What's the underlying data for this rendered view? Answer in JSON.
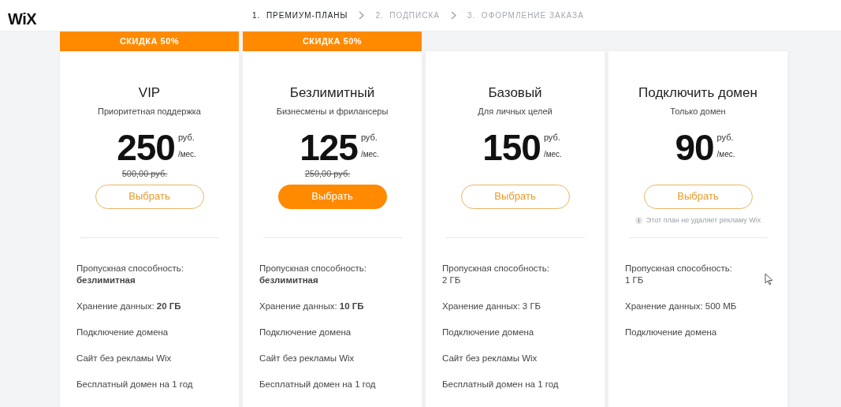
{
  "logo": "WiX",
  "steps": [
    {
      "number": "1.",
      "label": "ПРЕМИУМ-ПЛАНЫ",
      "selected": true
    },
    {
      "number": "2.",
      "label": "ПОДПИСКА",
      "selected": false
    },
    {
      "number": "3.",
      "label": "ОФОРМЛЕНИЕ ЗАКАЗА",
      "selected": false
    }
  ],
  "plans": [
    {
      "badge": "СКИДКА 50%",
      "name": "VIP",
      "subtitle": "Приоритетная поддержка",
      "price": "250",
      "currency": "руб.",
      "period": "/мес.",
      "old_price": "500,00 руб.",
      "button": {
        "label": "Выбрать",
        "primary": false
      },
      "features": [
        "Пропускная способность:\n**безлимитная**",
        "Хранение данных: **20 ГБ**",
        "Подключение домена",
        "Сайт без рекламы Wix",
        "Бесплатный домен на 1 год"
      ]
    },
    {
      "badge": "СКИДКА 50%",
      "name": "Безлимитный",
      "subtitle": "Бизнесмены и фрилансеры",
      "price": "125",
      "currency": "руб.",
      "period": "/мес.",
      "old_price": "250,00 руб.",
      "button": {
        "label": "Выбрать",
        "primary": true
      },
      "features": [
        "Пропускная способность:\n**безлимитная**",
        "Хранение данных: **10 ГБ**",
        "Подключение домена",
        "Сайт без рекламы Wix",
        "Бесплатный домен на 1 год"
      ]
    },
    {
      "name": "Базовый",
      "subtitle": "Для личных целей",
      "price": "150",
      "currency": "руб.",
      "period": "/мес.",
      "button": {
        "label": "Выбрать",
        "primary": false
      },
      "features": [
        "Пропускная способность:\n2 ГБ",
        "Хранение данных: 3 ГБ",
        "Подключение домена",
        "Сайт без рекламы Wix",
        "Бесплатный домен на 1 год"
      ]
    },
    {
      "name": "Подключить домен",
      "subtitle": "Только домен",
      "price": "90",
      "currency": "руб.",
      "period": "/мес.",
      "button": {
        "label": "Выбрать",
        "primary": false
      },
      "note": "Этот план не удаляет рекламу Wix",
      "features": [
        "Пропускная способность:\n1 ГБ",
        "Хранение данных: 500 МБ",
        "Подключение домена"
      ]
    }
  ]
}
